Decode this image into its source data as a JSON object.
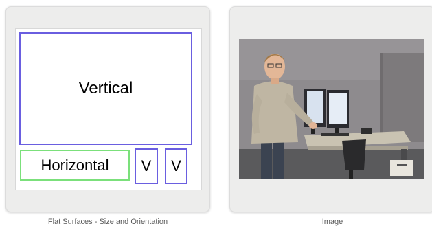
{
  "cards": {
    "left": {
      "regions": {
        "vertical_big": "Vertical",
        "horizontal": "Horizontal",
        "v1": "V",
        "v2": "V"
      },
      "caption": "Flat Surfaces - Size and Orientation"
    },
    "right": {
      "caption": "Image"
    }
  },
  "colors": {
    "vertical_border": "#6a5ee0",
    "horizontal_border": "#7be07b",
    "card_bg": "#ededec"
  }
}
